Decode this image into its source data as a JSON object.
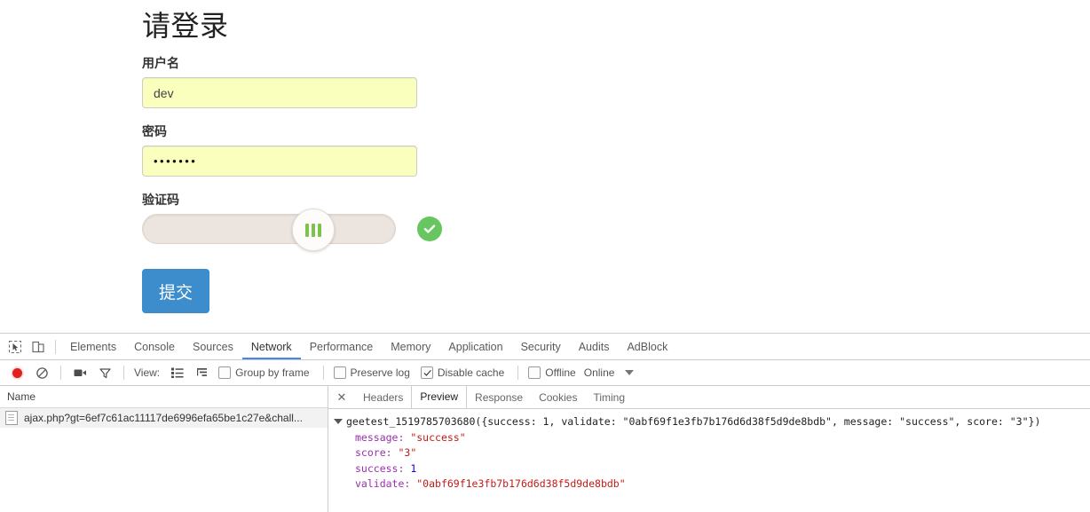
{
  "login": {
    "title": "请登录",
    "username": {
      "label": "用户名",
      "value": "dev",
      "placeholder": ""
    },
    "password": {
      "label": "密码",
      "value": "•••••••",
      "placeholder": ""
    },
    "captcha": {
      "label": "验证码",
      "state": "success"
    },
    "submit_label": "提交",
    "colors": {
      "autofill_bg": "#faffbd",
      "slider_track": "#ece4de",
      "slider_bars": "#7ac44d",
      "success_green": "#67c660",
      "submit_blue": "#3d8dcc"
    }
  },
  "devtools": {
    "icons": {
      "inspect": "inspect-cursor-icon",
      "device": "device-toolbar-icon",
      "record": "record-icon",
      "clear": "clear-icon",
      "camera": "screenshot-camera-icon",
      "filter": "filter-funnel-icon",
      "view_list": "view-list-icon",
      "view_waterfall": "view-waterfall-icon",
      "more": "more-options-caret-icon"
    },
    "tabs": [
      {
        "label": "Elements",
        "active": false
      },
      {
        "label": "Console",
        "active": false
      },
      {
        "label": "Sources",
        "active": false
      },
      {
        "label": "Network",
        "active": true
      },
      {
        "label": "Performance",
        "active": false
      },
      {
        "label": "Memory",
        "active": false
      },
      {
        "label": "Application",
        "active": false
      },
      {
        "label": "Security",
        "active": false
      },
      {
        "label": "Audits",
        "active": false
      },
      {
        "label": "AdBlock",
        "active": false
      }
    ],
    "toolbar": {
      "view_label": "View:",
      "group_by_frame": {
        "label": "Group by frame",
        "checked": false
      },
      "preserve_log": {
        "label": "Preserve log",
        "checked": false
      },
      "disable_cache": {
        "label": "Disable cache",
        "checked": true
      },
      "offline": {
        "label": "Offline",
        "checked": false
      },
      "online_label": "Online"
    },
    "request_list": {
      "column_name": "Name",
      "rows": [
        {
          "name": "ajax.php?gt=6ef7c61ac11117de6996efa65be1c27e&chall...",
          "selected": true
        }
      ]
    },
    "detail": {
      "tabs": [
        {
          "label": "Headers",
          "active": false
        },
        {
          "label": "Preview",
          "active": true
        },
        {
          "label": "Response",
          "active": false
        },
        {
          "label": "Cookies",
          "active": false
        },
        {
          "label": "Timing",
          "active": false
        }
      ],
      "preview": {
        "callback": "geetest_1519785703680({success: 1, validate: \"0abf69f1e3fb7b176d6d38f5d9de8bdb\", message: \"success\", score: \"3\"})",
        "properties": [
          {
            "key": "message:",
            "value": "\"success\"",
            "type": "string"
          },
          {
            "key": "score:",
            "value": "\"3\"",
            "type": "string"
          },
          {
            "key": "success:",
            "value": "1",
            "type": "number"
          },
          {
            "key": "validate:",
            "value": "\"0abf69f1e3fb7b176d6d38f5d9de8bdb\"",
            "type": "string"
          }
        ]
      }
    }
  }
}
